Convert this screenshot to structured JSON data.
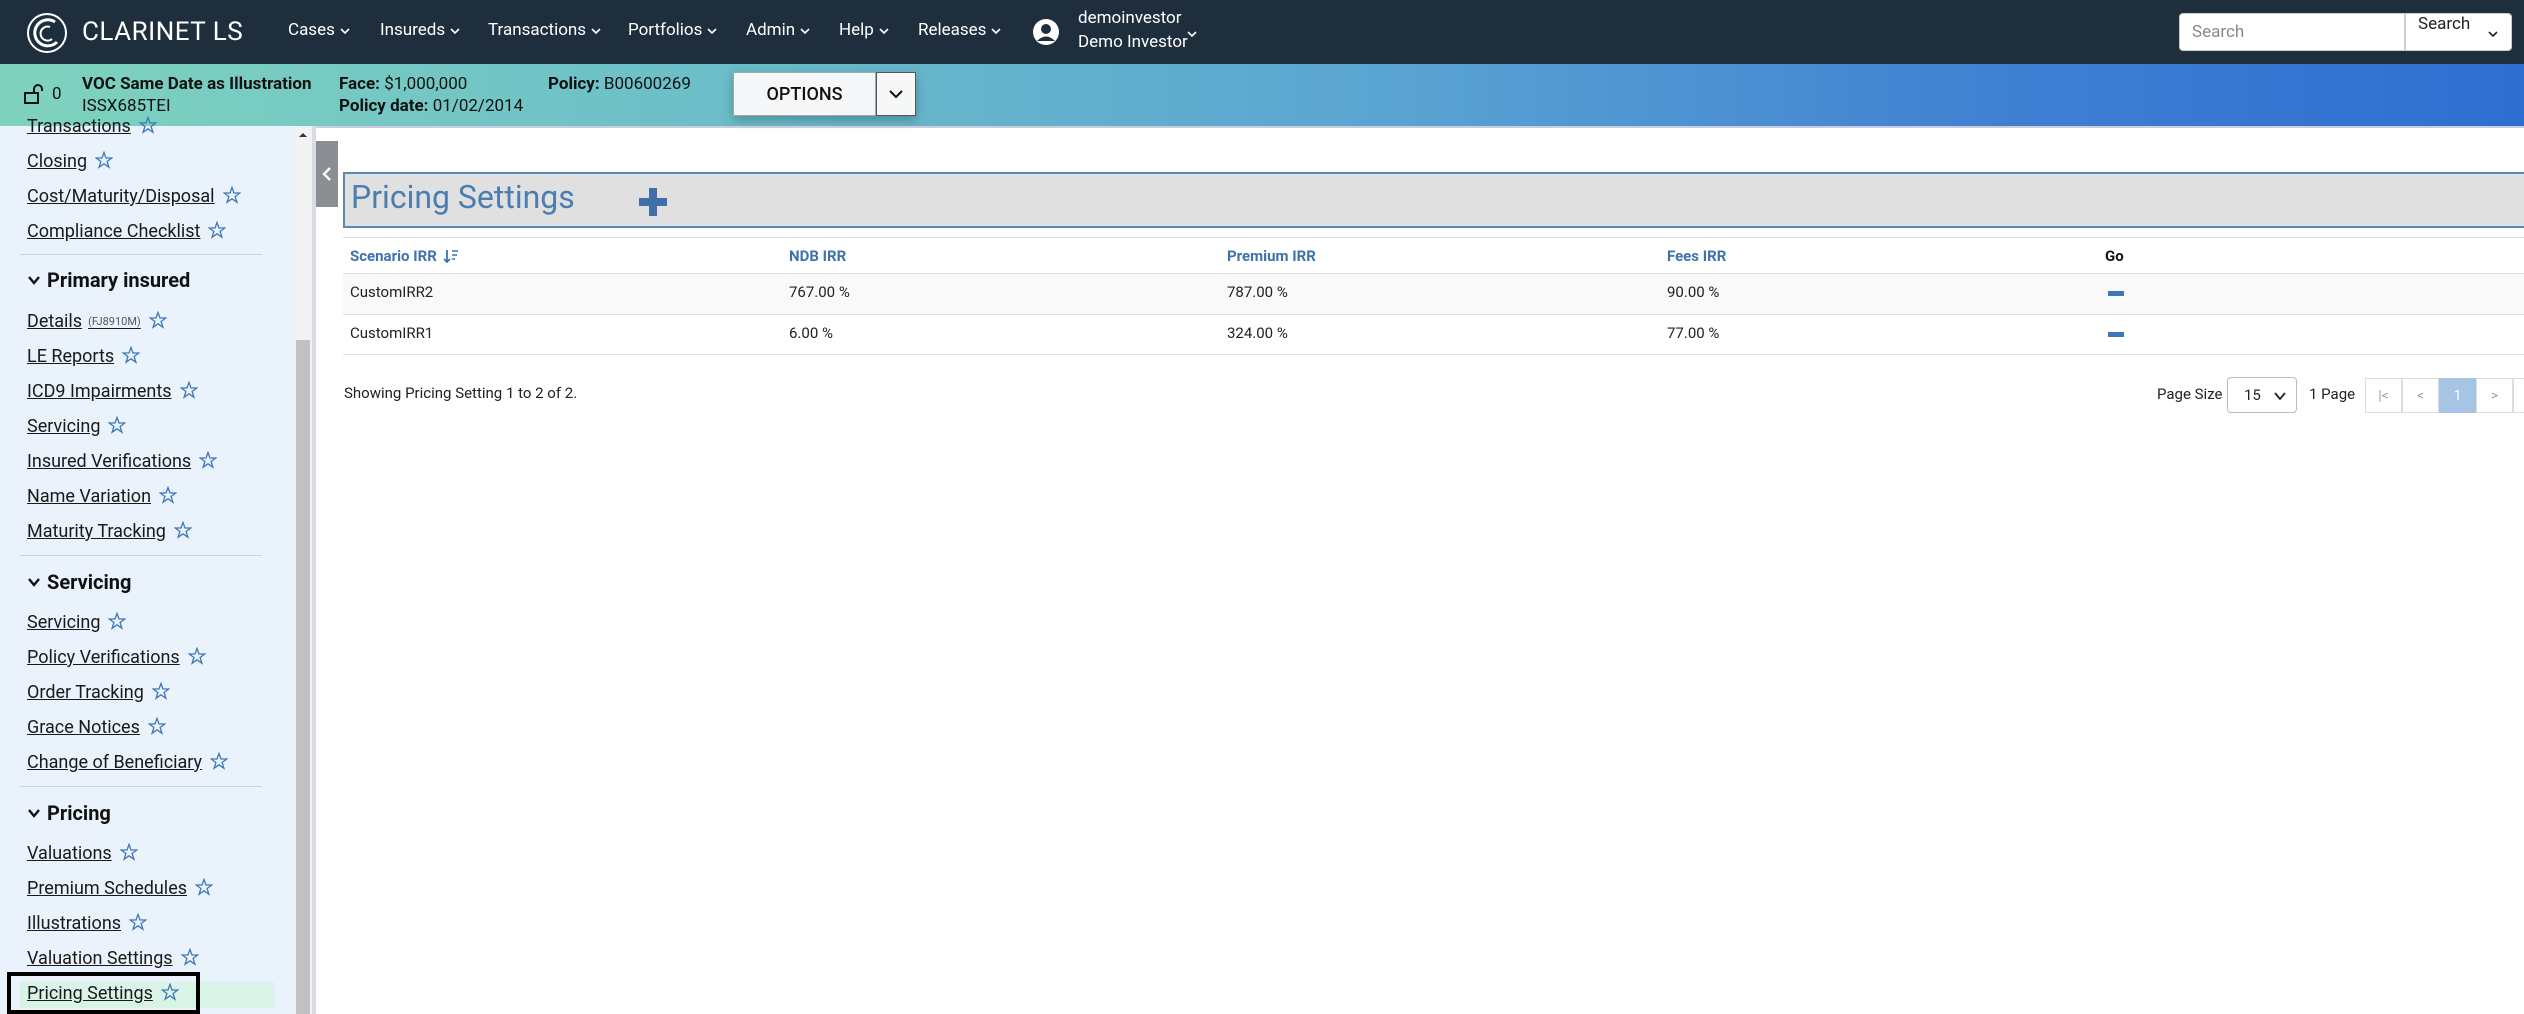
{
  "app": {
    "brand": "CLARINET LS"
  },
  "nav": {
    "cases": "Cases",
    "insureds": "Insureds",
    "transactions": "Transactions",
    "portfolios": "Portfolios",
    "admin": "Admin",
    "help": "Help",
    "releases": "Releases"
  },
  "user": {
    "name": "demoinvestor",
    "role": "Demo Investor"
  },
  "search": {
    "placeholder": "Search",
    "button_label": "Search"
  },
  "policy": {
    "lock_count": "0",
    "case_name": "VOC Same Date as Illustration",
    "case_id": "ISSX685TEI",
    "face_label": "Face:",
    "face_value": "$1,000,000",
    "policy_label": "Policy:",
    "policy_value": "B00600269",
    "date_label": "Policy date:",
    "date_value": "01/02/2014",
    "options_label": "OPTIONS"
  },
  "sidebar": {
    "top_links": [
      "Transactions",
      "Closing",
      "Cost/Maturity/Disposal",
      "Compliance Checklist"
    ],
    "primary_insured": {
      "heading": "Primary insured",
      "details_label": "Details",
      "details_tag": "(FJ8910M)",
      "links": [
        "LE Reports",
        "ICD9 Impairments",
        "Servicing",
        "Insured Verifications",
        "Name Variation",
        "Maturity Tracking"
      ]
    },
    "servicing": {
      "heading": "Servicing",
      "links": [
        "Servicing",
        "Policy Verifications",
        "Order Tracking",
        "Grace Notices",
        "Change of Beneficiary"
      ]
    },
    "pricing": {
      "heading": "Pricing",
      "links": [
        "Valuations",
        "Premium Schedules",
        "Illustrations",
        "Valuation Settings",
        "Pricing Settings"
      ]
    }
  },
  "main": {
    "title": "Pricing Settings",
    "table": {
      "columns": [
        "Scenario IRR",
        "NDB IRR",
        "Premium IRR",
        "Fees IRR",
        "Go"
      ],
      "rows": [
        [
          "CustomIRR2",
          "767.00 %",
          "787.00 %",
          "90.00 %"
        ],
        [
          "CustomIRR1",
          "6.00 %",
          "324.00 %",
          "77.00 %"
        ]
      ]
    },
    "summary": "Showing Pricing Setting 1 to 2 of 2.",
    "pagination": {
      "page_size_label": "Page Size",
      "page_size_value": "15",
      "page_count": "1 Page",
      "first": "|<",
      "prev": "<",
      "current": "1",
      "next": ">",
      "last": ">|"
    }
  },
  "colors": {
    "nav_bg": "#1f2e3d",
    "accent_blue": "#4c7db0",
    "sidebar_bg": "#eaf3fb",
    "active_green": "#d9f4e6"
  },
  "icons": [
    "logo-icon",
    "chevron-down-icon",
    "user-circle-icon",
    "lock-open-icon",
    "star-icon",
    "caret-down-icon",
    "collapse-left-icon",
    "plus-icon",
    "sort-icon",
    "minus-icon"
  ]
}
